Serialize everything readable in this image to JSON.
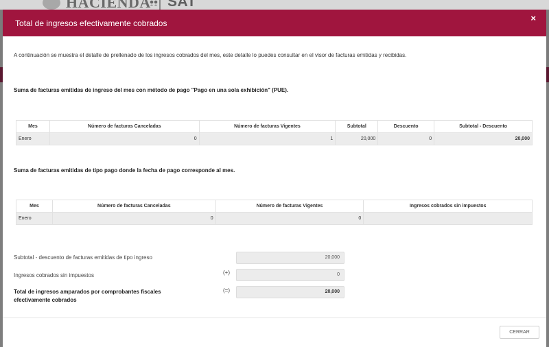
{
  "backdrop": {
    "logo_hacienda": "HACIENDA",
    "logo_sat": "SAT"
  },
  "modal": {
    "title": "Total de ingresos efectivamente cobrados",
    "close_label": "×",
    "intro": "A continuación se muestra el detalle de prellenado de los ingresos cobrados del mes, este detalle lo puedes consultar en el visor de facturas emitidas y recibidas.",
    "section1": {
      "title": "Suma de facturas emitidas de ingreso del mes con método de pago \"Pago en una sola exhibición\" (PUE).",
      "headers": [
        "Mes",
        "Número de facturas Canceladas",
        "Número de facturas Vigentes",
        "Subtotal",
        "Descuento",
        "Subtotal - Descuento"
      ],
      "rows": [
        [
          "Enero",
          "0",
          "1",
          "20,000",
          "0",
          "20,000"
        ]
      ]
    },
    "section2": {
      "title": "Suma de facturas emitidas de tipo pago donde la fecha de pago corresponde al mes.",
      "headers": [
        "Mes",
        "Número de facturas Canceladas",
        "Número de facturas Vigentes",
        "Ingresos cobrados sin impuestos"
      ],
      "rows": [
        [
          "Enero",
          "0",
          "0",
          ""
        ]
      ]
    },
    "summary": {
      "subtotal_label": "Subtotal - descuento de facturas emitidas de tipo ingreso",
      "subtotal_value": "20,000",
      "ingresos_label": "Ingresos cobrados sin impuestos",
      "ingresos_op": "(+)",
      "ingresos_value": "0",
      "total_label": "Total de ingresos amparados por comprobantes fiscales efectivamente cobrados",
      "total_op": "(=)",
      "total_value": "20,000"
    },
    "close_button": "CERRAR"
  },
  "colors": {
    "header": "#a0153e",
    "backdrop_band": "#5a1830",
    "row_fill": "#ececec"
  }
}
